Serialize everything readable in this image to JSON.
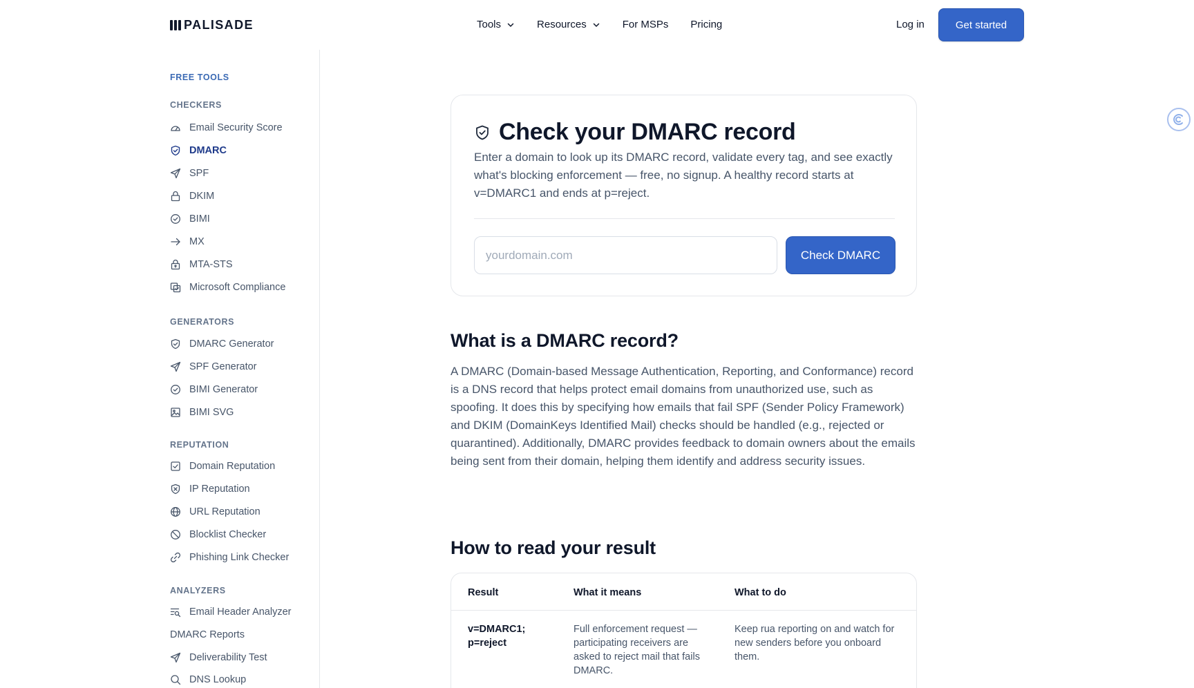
{
  "header": {
    "logo_text": "PALISADE",
    "nav": [
      {
        "label": "Tools",
        "has_dropdown": true
      },
      {
        "label": "Resources",
        "has_dropdown": true
      },
      {
        "label": "For MSPs",
        "has_dropdown": false
      },
      {
        "label": "Pricing",
        "has_dropdown": false
      }
    ],
    "login_label": "Log in",
    "cta_label": "Get started"
  },
  "sidebar": {
    "title": "FREE TOOLS",
    "sections": [
      {
        "label": "CHECKERS",
        "items": [
          {
            "label": "Email Security Score",
            "icon": "gauge-icon"
          },
          {
            "label": "DMARC",
            "icon": "shield-check-icon",
            "active": true
          },
          {
            "label": "SPF",
            "icon": "send-icon"
          },
          {
            "label": "DKIM",
            "icon": "lock-icon"
          },
          {
            "label": "BIMI",
            "icon": "badge-check-icon"
          },
          {
            "label": "MX",
            "icon": "arrow-right-icon"
          },
          {
            "label": "MTA-STS",
            "icon": "lock-keyhole-icon"
          },
          {
            "label": "Microsoft Compliance",
            "icon": "compliance-icon"
          }
        ]
      },
      {
        "label": "GENERATORS",
        "items": [
          {
            "label": "DMARC Generator",
            "icon": "shield-check-icon"
          },
          {
            "label": "SPF Generator",
            "icon": "send-icon"
          },
          {
            "label": "BIMI Generator",
            "icon": "badge-check-icon"
          },
          {
            "label": "BIMI SVG",
            "icon": "image-icon"
          }
        ]
      },
      {
        "label": "REPUTATION",
        "items": [
          {
            "label": "Domain Reputation",
            "icon": "checkbox-icon"
          },
          {
            "label": "IP Reputation",
            "icon": "shield-x-icon"
          },
          {
            "label": "URL Reputation",
            "icon": "globe-icon"
          },
          {
            "label": "Blocklist Checker",
            "icon": "ban-icon"
          },
          {
            "label": "Phishing Link Checker",
            "icon": "link-icon"
          }
        ]
      },
      {
        "label": "ANALYZERS",
        "items": [
          {
            "label": "Email Header Analyzer",
            "icon": "text-search-icon"
          },
          {
            "label": "DMARC Reports",
            "icon": ""
          },
          {
            "label": "Deliverability Test",
            "icon": "send-icon"
          },
          {
            "label": "DNS Lookup",
            "icon": "search-icon"
          }
        ]
      }
    ]
  },
  "checker": {
    "title": "Check your DMARC record",
    "description": "Enter a domain to look up its DMARC record, validate every tag, and see exactly what's blocking enforcement — free, no signup. A healthy record starts at v=DMARC1 and ends at p=reject.",
    "input_value": "",
    "input_placeholder": "yourdomain.com",
    "button_label": "Check DMARC"
  },
  "about": {
    "heading": "What is a DMARC record?",
    "body": "A DMARC (Domain-based Message Authentication, Reporting, and Conformance) record is a DNS record that helps protect email domains from unauthorized use, such as spoofing. It does this by specifying how emails that fail SPF (Sender Policy Framework) and DKIM (DomainKeys Identified Mail) checks should be handled (e.g., rejected or quarantined). Additionally, DMARC provides feedback to domain owners about the emails being sent from their domain, helping them identify and address security issues."
  },
  "results": {
    "heading": "How to read your result",
    "columns": [
      "Result",
      "What it means",
      "What to do"
    ],
    "rows": [
      [
        "v=DMARC1; p=reject",
        "Full enforcement request — participating receivers are asked to reject mail that fails DMARC.",
        "Keep rua reporting on and watch for new senders before you onboard them."
      ]
    ]
  },
  "colors": {
    "accent": "#3465c8",
    "active_nav": "#1e3a8a",
    "section_title": "#3b6ab4"
  }
}
